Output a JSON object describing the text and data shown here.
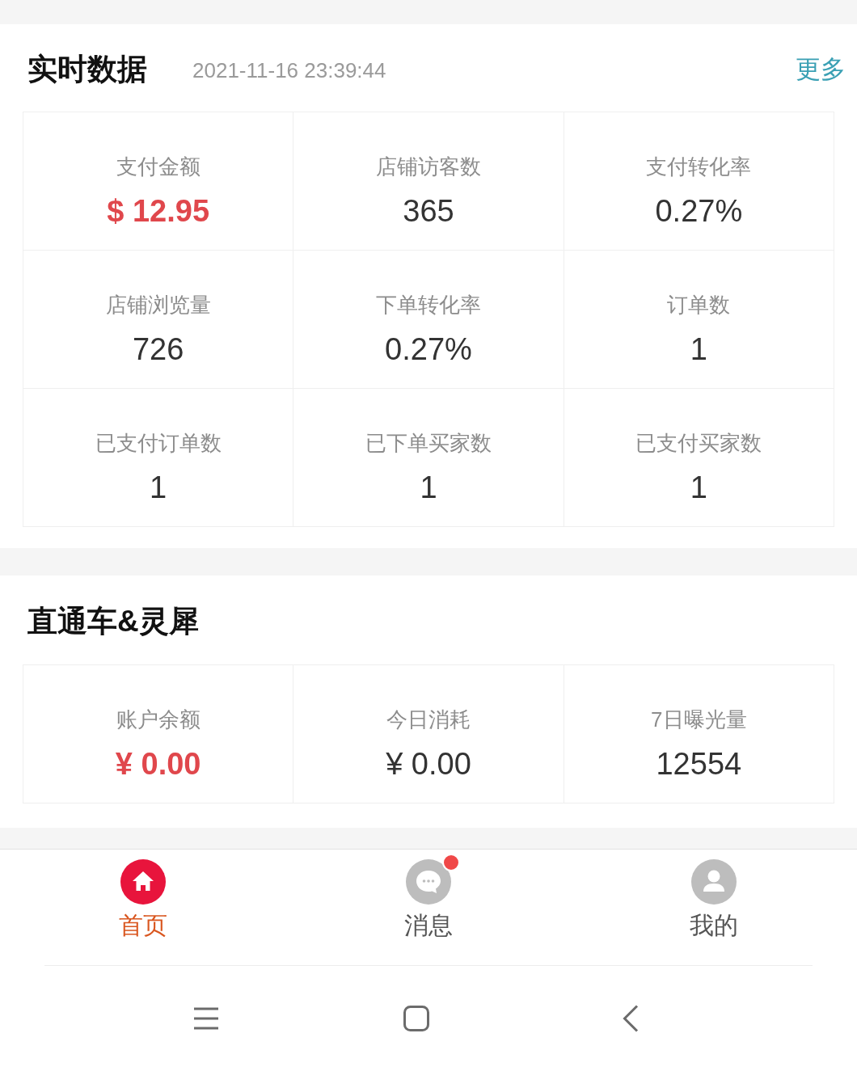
{
  "realtime": {
    "title": "实时数据",
    "timestamp": "2021-11-16 23:39:44",
    "more_link": "更多",
    "metrics": [
      {
        "label": "支付金额",
        "value": "$ 12.95",
        "highlighted": true
      },
      {
        "label": "店铺访客数",
        "value": "365",
        "highlighted": false
      },
      {
        "label": "支付转化率",
        "value": "0.27%",
        "highlighted": false
      },
      {
        "label": "店铺浏览量",
        "value": "726",
        "highlighted": false
      },
      {
        "label": "下单转化率",
        "value": "0.27%",
        "highlighted": false
      },
      {
        "label": "订单数",
        "value": "1",
        "highlighted": false
      },
      {
        "label": "已支付订单数",
        "value": "1",
        "highlighted": false
      },
      {
        "label": "已下单买家数",
        "value": "1",
        "highlighted": false
      },
      {
        "label": "已支付买家数",
        "value": "1",
        "highlighted": false
      }
    ]
  },
  "ads": {
    "title": "直通车&灵犀",
    "metrics": [
      {
        "label": "账户余额",
        "value": "¥ 0.00",
        "highlighted": true
      },
      {
        "label": "今日消耗",
        "value": "¥ 0.00",
        "highlighted": false
      },
      {
        "label": "7日曝光量",
        "value": "12554",
        "highlighted": false
      }
    ]
  },
  "tab_bar": {
    "tabs": [
      {
        "label": "首页",
        "selected": true,
        "unread": false
      },
      {
        "label": "消息",
        "selected": false,
        "unread": true
      },
      {
        "label": "我的",
        "selected": false,
        "unread": false
      }
    ]
  }
}
